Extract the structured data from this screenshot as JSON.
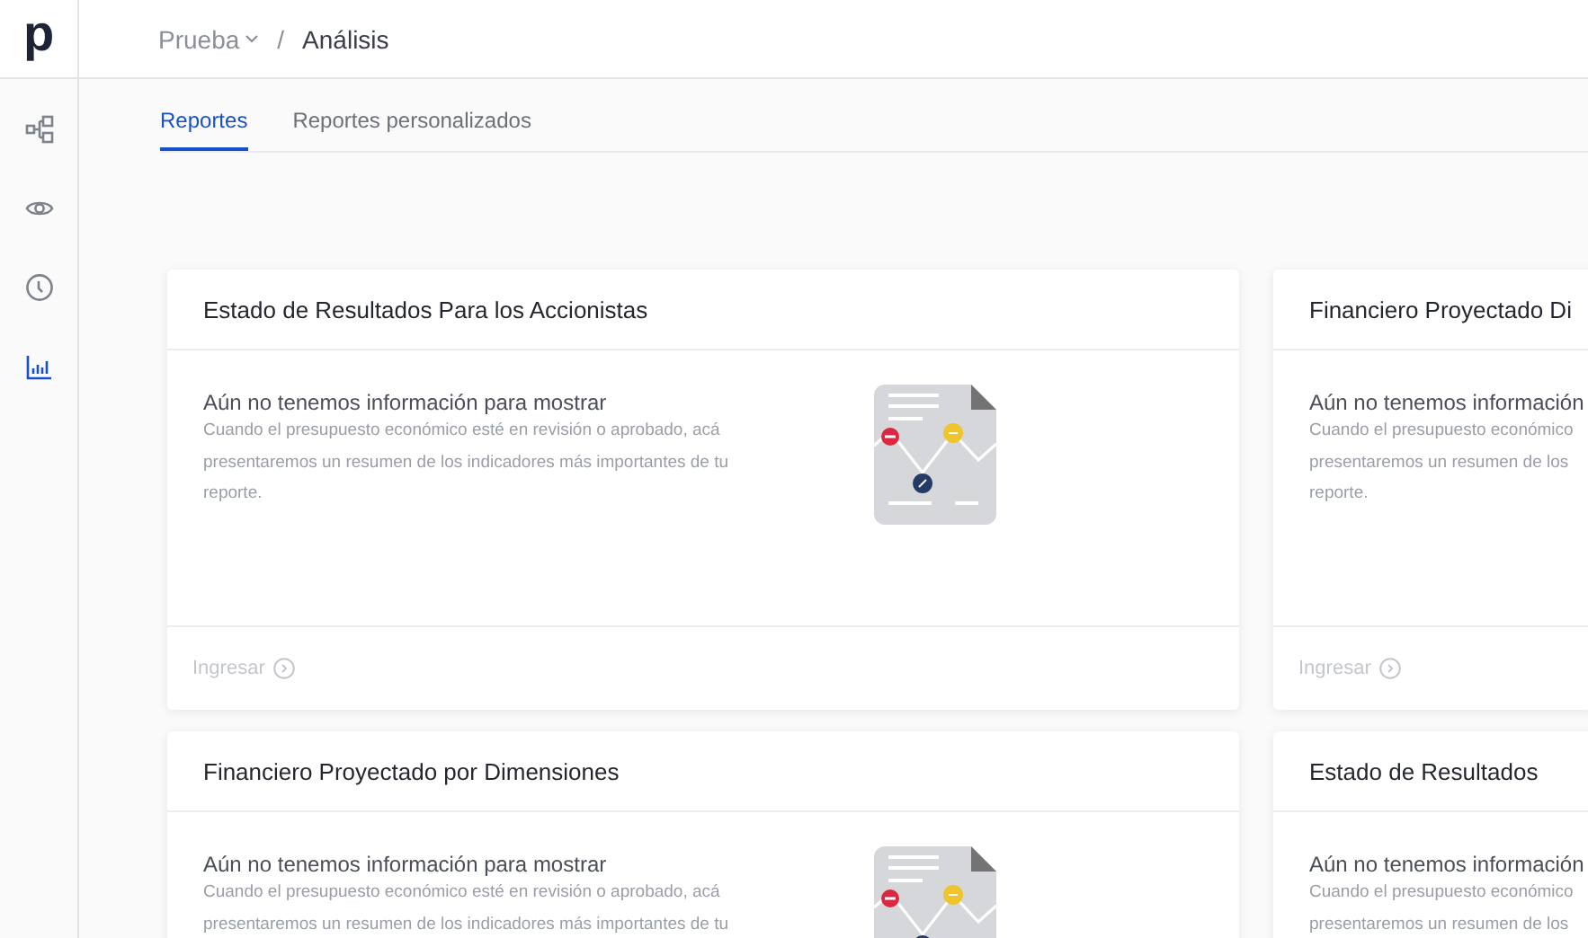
{
  "logo": "p",
  "sidebar": {
    "items": [
      {
        "selected": false
      },
      {
        "selected": false
      },
      {
        "selected": false
      },
      {
        "selected": true
      }
    ]
  },
  "breadcrumb": {
    "project": "Prueba",
    "separator": "/",
    "page": "Análisis"
  },
  "tabs": [
    {
      "label": "Reportes",
      "selected": true
    },
    {
      "label": "Reportes personalizados",
      "selected": false
    }
  ],
  "cards": [
    {
      "title": "Estado de Resultados Para los Accionistas",
      "message": "Aún no tenemos información para mostrar",
      "description_lines": [
        "Cuando el presupuesto económico esté en revisión o aprobado, acá",
        "presentaremos un resumen de los indicadores más importantes de tu",
        "reporte."
      ],
      "illustration": true,
      "link": "Ingresar"
    },
    {
      "title": "Financiero Proyectado Di",
      "message": "Aún no tenemos información",
      "description_lines": [
        "Cuando el presupuesto económico",
        "presentaremos un resumen de los",
        "reporte."
      ],
      "illustration": false,
      "link": "Ingresar"
    },
    {
      "title": "Financiero Proyectado por Dimensiones",
      "message": "Aún no tenemos información para mostrar",
      "description_lines": [
        "Cuando el presupuesto económico esté en revisión o aprobado, acá",
        "presentaremos un resumen de los indicadores más importantes de tu"
      ],
      "illustration": true
    },
    {
      "title": "Estado de Resultados",
      "message": "Aún no tenemos información",
      "description_lines": [
        "Cuando el presupuesto económico",
        "presentaremos un resumen de los"
      ],
      "illustration": false
    }
  ]
}
